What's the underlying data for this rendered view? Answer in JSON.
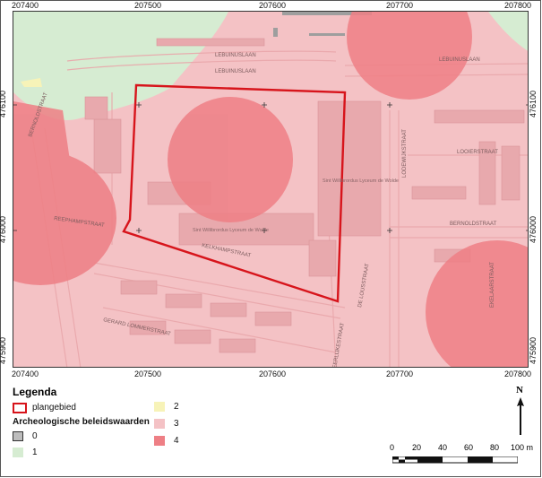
{
  "map": {
    "x_ticks": [
      "207400",
      "207500",
      "207600",
      "207700",
      "207800"
    ],
    "y_ticks": [
      "476100",
      "476000",
      "475900"
    ],
    "street_labels": [
      "LEBUINUSLAAN",
      "LEBUINUSLAAN",
      "LEBUINUSLAAN",
      "LODEWIJKSTRAAT",
      "LOOIERSTRAAT",
      "BERNOLDSTRAAT",
      "EKELAARSTRAAT",
      "REEPHAMPSTRAAT",
      "GERARD LOMMERSTRAAT",
      "KELKHAMPSTRAAT",
      "BERNOLDSTRAAT",
      "DE LOUSSTRAAT",
      "EERLIJKESTRAAT"
    ],
    "building_labels": [
      "Sint Willibrordus Lyceum de Wolde",
      "Sint Willibrordus Lyceum de Wolde"
    ],
    "colors": {
      "value1": "#d6ecd2",
      "value3": "#f2b9bd",
      "value4": "#ee7f85",
      "plan_outline": "#d7141b"
    }
  },
  "legend": {
    "title": "Legenda",
    "plan_label": "plangebied",
    "category_title": "Archeologische beleidswaarden",
    "items": [
      {
        "label": "0",
        "color": "#bdbdbd"
      },
      {
        "label": "1",
        "color": "#d6ecd2"
      },
      {
        "label": "2",
        "color": "#f7f3b8"
      },
      {
        "label": "3",
        "color": "#f4c2c5"
      },
      {
        "label": "4",
        "color": "#ee7f85"
      }
    ]
  },
  "north": {
    "label": "N"
  },
  "scalebar": {
    "ticks": [
      "0",
      "20",
      "40",
      "60",
      "80"
    ],
    "end_label": "100 m"
  }
}
